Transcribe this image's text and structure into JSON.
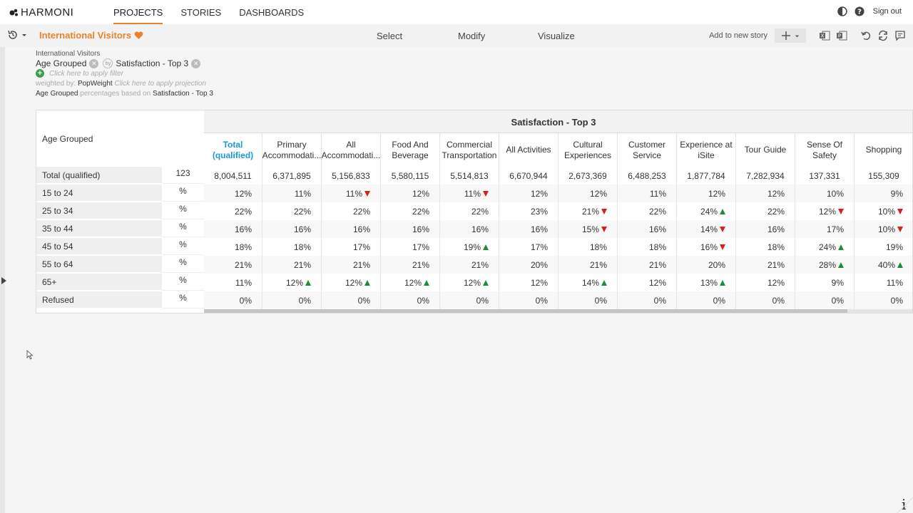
{
  "app": {
    "brand": "HARMONI"
  },
  "nav": {
    "items": [
      {
        "label": "PROJECTS",
        "active": true
      },
      {
        "label": "STORIES",
        "active": false
      },
      {
        "label": "DASHBOARDS",
        "active": false
      }
    ],
    "signout": "Sign out"
  },
  "toolbar": {
    "title": "International Visitors",
    "tabs": [
      "Select",
      "Modify",
      "Visualize"
    ],
    "add_to_story": "Add to new story",
    "accent": "#e8832a"
  },
  "info": {
    "dataset": "International Visitors",
    "row_var": "Age Grouped",
    "col_var": "Satisfaction - Top 3",
    "by_label": "by",
    "filter_hint": "Click here to apply filter",
    "weighted_prefix": "weighted by:",
    "weight": "PopWeight",
    "projection_hint": "Click here to apply projection",
    "based_row": "Age Grouped",
    "based_text": "percentages based on",
    "based_col": "Satisfaction - Top 3"
  },
  "table": {
    "group_header": "Satisfaction - Top 3",
    "row_header_title": "Age Grouped",
    "columns": [
      "Total (qualified)",
      "Primary Accommodati...",
      "All Accommodati...",
      "Food And Beverage",
      "Commercial Transportation",
      "All Activities",
      "Cultural Experiences",
      "Customer Service",
      "Experience at iSite",
      "Tour Guide",
      "Sense Of Safety",
      "Shopping"
    ],
    "rows": [
      {
        "label": "Total (qualified)",
        "unit": "123",
        "values": [
          "8,004,511",
          "6,371,895",
          "5,156,833",
          "5,580,115",
          "5,514,813",
          "6,670,944",
          "2,673,369",
          "6,488,253",
          "1,877,784",
          "7,282,934",
          "137,331",
          "155,309"
        ],
        "flags": [
          "",
          "",
          "",
          "",
          "",
          "",
          "",
          "",
          "",
          "",
          "",
          ""
        ]
      },
      {
        "label": "15 to 24",
        "unit": "%",
        "values": [
          "12%",
          "11%",
          "11%",
          "12%",
          "11%",
          "12%",
          "12%",
          "11%",
          "12%",
          "12%",
          "10%",
          "9%"
        ],
        "flags": [
          "",
          "",
          "down",
          "",
          "down",
          "",
          "",
          "",
          "",
          "",
          "",
          ""
        ]
      },
      {
        "label": "25 to 34",
        "unit": "%",
        "values": [
          "22%",
          "22%",
          "22%",
          "22%",
          "22%",
          "23%",
          "21%",
          "22%",
          "24%",
          "22%",
          "12%",
          "10%"
        ],
        "flags": [
          "",
          "",
          "",
          "",
          "",
          "",
          "down",
          "",
          "up",
          "",
          "down",
          "down"
        ]
      },
      {
        "label": "35 to 44",
        "unit": "%",
        "values": [
          "16%",
          "16%",
          "16%",
          "16%",
          "16%",
          "16%",
          "15%",
          "16%",
          "14%",
          "16%",
          "17%",
          "10%"
        ],
        "flags": [
          "",
          "",
          "",
          "",
          "",
          "",
          "down",
          "",
          "down",
          "",
          "",
          "down"
        ]
      },
      {
        "label": "45 to 54",
        "unit": "%",
        "values": [
          "18%",
          "18%",
          "17%",
          "17%",
          "19%",
          "17%",
          "18%",
          "18%",
          "16%",
          "18%",
          "24%",
          "19%"
        ],
        "flags": [
          "",
          "",
          "",
          "",
          "up",
          "",
          "",
          "",
          "down",
          "",
          "up",
          ""
        ]
      },
      {
        "label": "55 to 64",
        "unit": "%",
        "values": [
          "21%",
          "21%",
          "21%",
          "21%",
          "21%",
          "20%",
          "21%",
          "21%",
          "20%",
          "21%",
          "28%",
          "40%"
        ],
        "flags": [
          "",
          "",
          "",
          "",
          "",
          "",
          "",
          "",
          "",
          "",
          "up",
          "up"
        ]
      },
      {
        "label": "65+",
        "unit": "%",
        "values": [
          "11%",
          "12%",
          "12%",
          "12%",
          "12%",
          "12%",
          "14%",
          "12%",
          "13%",
          "12%",
          "9%",
          "11%"
        ],
        "flags": [
          "",
          "up",
          "up",
          "up",
          "up",
          "",
          "up",
          "",
          "up",
          "",
          "",
          ""
        ]
      },
      {
        "label": "Refused",
        "unit": "%",
        "values": [
          "0%",
          "0%",
          "0%",
          "0%",
          "0%",
          "0%",
          "0%",
          "0%",
          "0%",
          "0%",
          "0%",
          "0%"
        ],
        "flags": [
          "",
          "",
          "",
          "",
          "",
          "",
          "",
          "",
          "",
          "",
          "",
          ""
        ]
      }
    ],
    "colors": {
      "total_header": "#1a9ad6",
      "up": "#1e8c3a",
      "down": "#d62020"
    }
  }
}
